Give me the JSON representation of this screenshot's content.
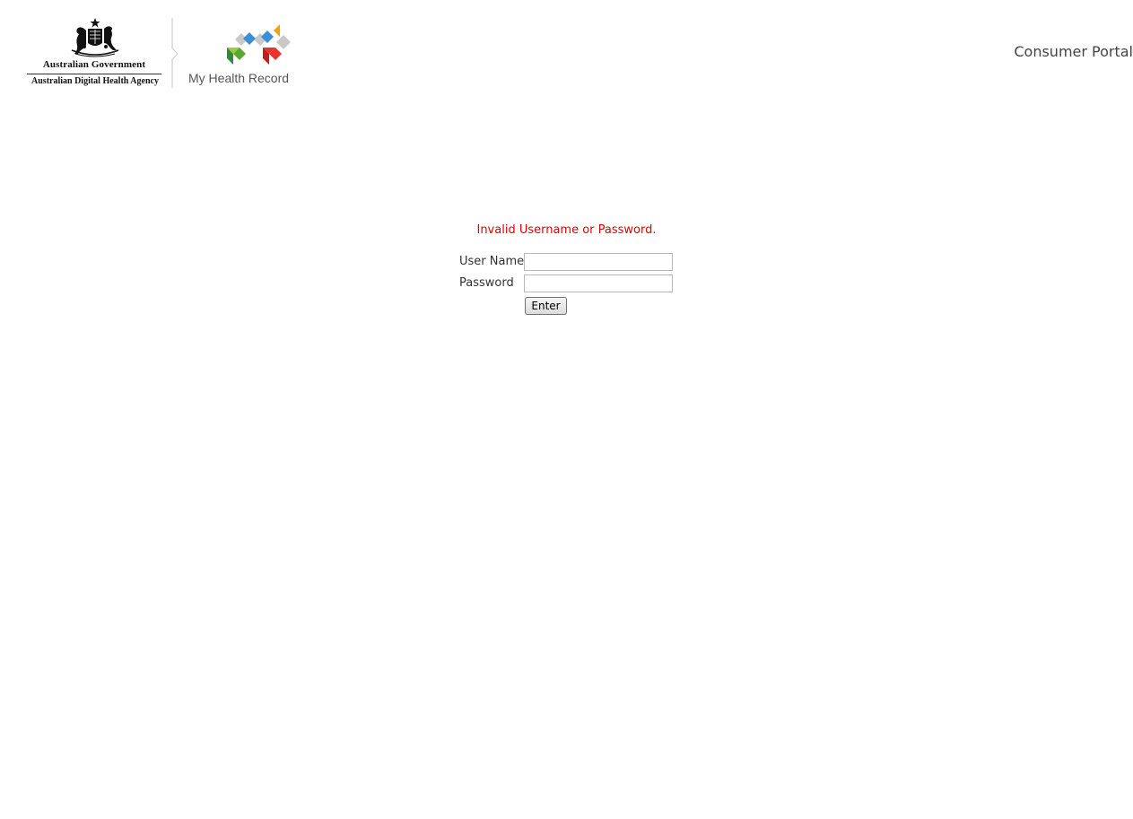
{
  "header": {
    "gov_name": "Australian Government",
    "agency_name": "Australian Digital Health Agency",
    "product_name": "My Health Record",
    "portal_title": "Consumer Portal",
    "icons": [
      "coat-of-arms-icon",
      "my-health-record-logo-icon"
    ]
  },
  "login": {
    "error_message": "Invalid Username or Password.",
    "username_label": "User Name",
    "username_value": "",
    "password_label": "Password",
    "password_value": "",
    "submit_label": "Enter"
  },
  "colors": {
    "error": "#e00000",
    "logo_green": "#5aa832",
    "logo_blue": "#3b8fd4",
    "logo_red": "#e8322a",
    "logo_orange": "#f5a20a"
  }
}
